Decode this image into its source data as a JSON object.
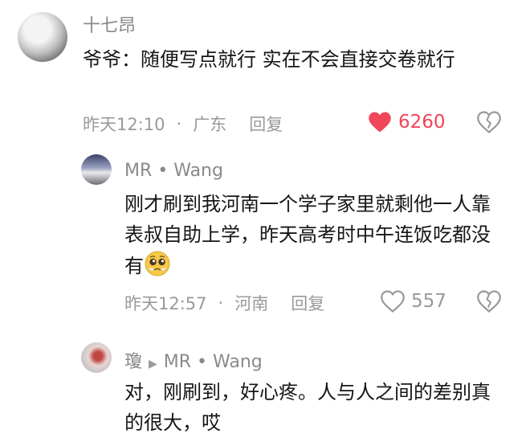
{
  "comments": [
    {
      "author": "十七昂",
      "text": "爷爷：随便写点就行 实在不会直接交卷就行",
      "time": "昨天12:10",
      "location": "广东",
      "reply_label": "回复",
      "likes": "6260",
      "liked": true
    },
    {
      "author": "MR • Wang",
      "text": "刚才刷到我河南一个学子家里就剩他一人靠表叔自助上学，昨天高考时中午连饭吃都没有",
      "emoji": "pleading-face",
      "time": "昨天12:57",
      "location": "河南",
      "reply_label": "回复",
      "likes": "557",
      "liked": false
    },
    {
      "author": "瓊",
      "reply_to": "MR • Wang",
      "text": "对，刚刷到，好心疼。人与人之间的差别真的很大，哎"
    }
  ],
  "colors": {
    "liked_heart": "#f0455a",
    "muted": "#9a9a9a"
  }
}
